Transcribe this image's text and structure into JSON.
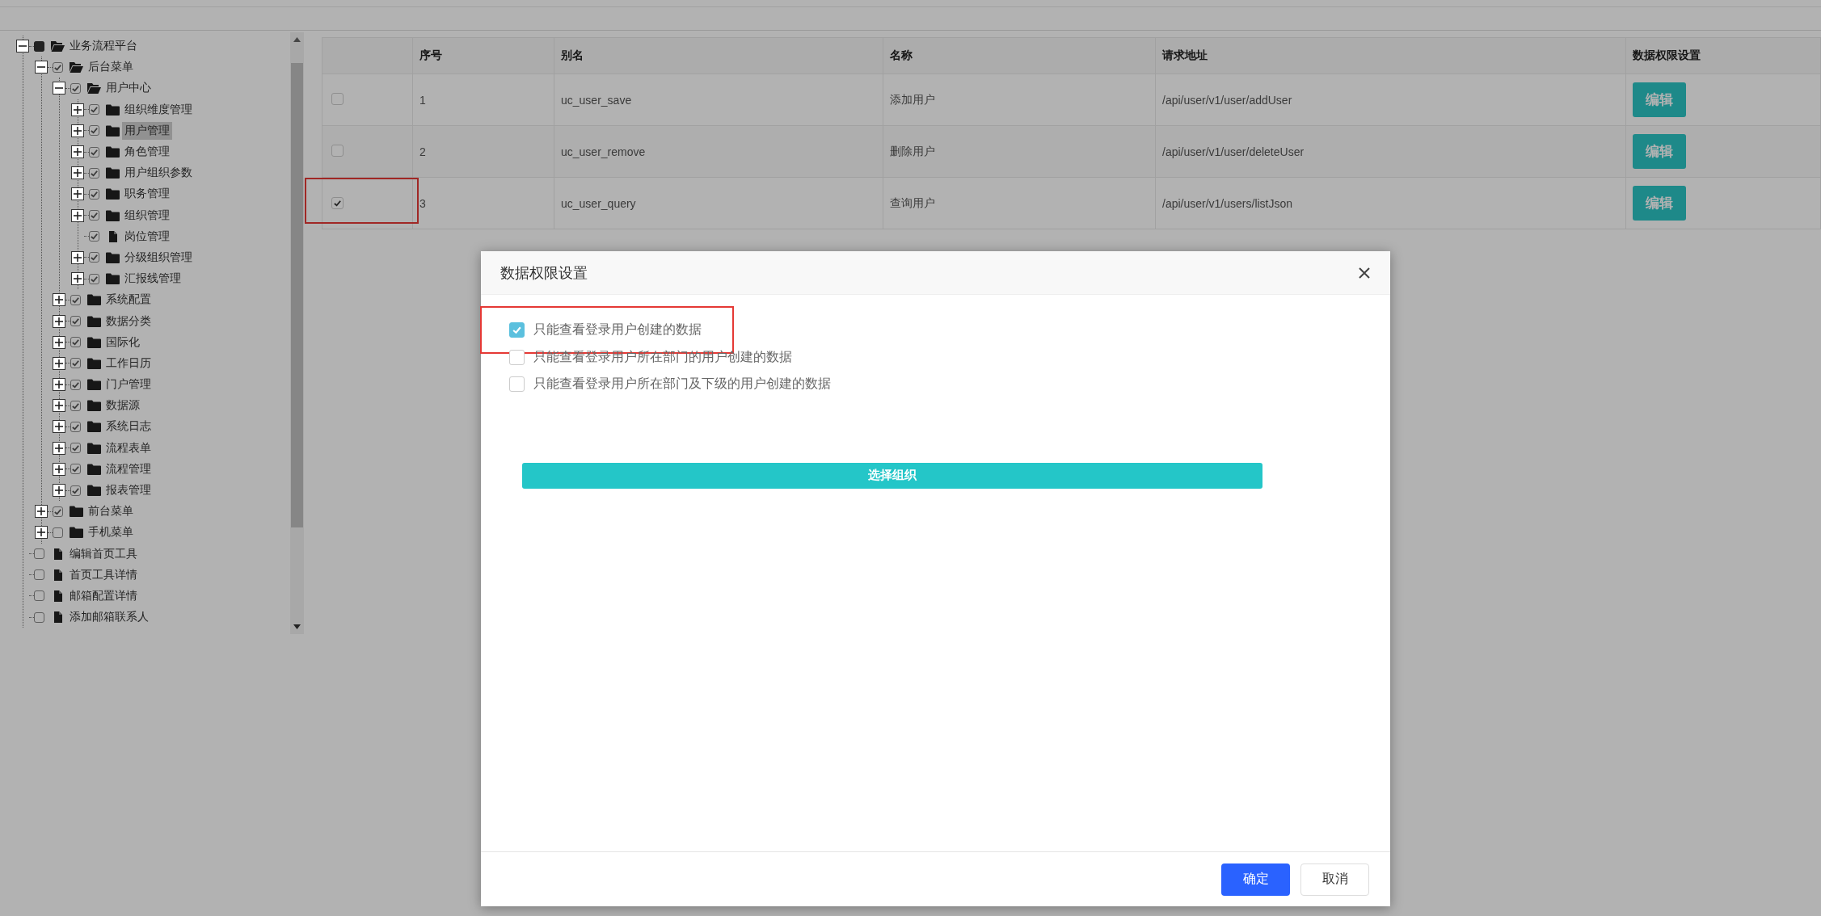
{
  "tree": [
    {
      "label": "业务流程平台",
      "kind": "folder",
      "expanded": true,
      "checked": false,
      "indeterminate": true,
      "selected": false,
      "children": [
        {
          "label": "后台菜单",
          "kind": "folder",
          "expanded": true,
          "checked": true,
          "indeterminate": false,
          "selected": false,
          "children": [
            {
              "label": "用户中心",
              "kind": "folder",
              "expanded": true,
              "checked": true,
              "indeterminate": false,
              "selected": false,
              "children": [
                {
                  "label": "组织维度管理",
                  "kind": "folder",
                  "expanded": false,
                  "checked": true,
                  "indeterminate": false,
                  "selected": false
                },
                {
                  "label": "用户管理",
                  "kind": "folder",
                  "expanded": false,
                  "checked": true,
                  "indeterminate": false,
                  "selected": true
                },
                {
                  "label": "角色管理",
                  "kind": "folder",
                  "expanded": false,
                  "checked": true,
                  "indeterminate": false,
                  "selected": false
                },
                {
                  "label": "用户组织参数",
                  "kind": "folder",
                  "expanded": false,
                  "checked": true,
                  "indeterminate": false,
                  "selected": false
                },
                {
                  "label": "职务管理",
                  "kind": "folder",
                  "expanded": false,
                  "checked": true,
                  "indeterminate": false,
                  "selected": false
                },
                {
                  "label": "组织管理",
                  "kind": "folder",
                  "expanded": false,
                  "checked": true,
                  "indeterminate": false,
                  "selected": false
                },
                {
                  "label": "岗位管理",
                  "kind": "file",
                  "checked": true,
                  "indeterminate": false,
                  "selected": false
                },
                {
                  "label": "分级组织管理",
                  "kind": "folder",
                  "expanded": false,
                  "checked": true,
                  "indeterminate": false,
                  "selected": false
                },
                {
                  "label": "汇报线管理",
                  "kind": "folder",
                  "expanded": false,
                  "checked": true,
                  "indeterminate": false,
                  "selected": false
                }
              ]
            },
            {
              "label": "系统配置",
              "kind": "folder",
              "expanded": false,
              "checked": true,
              "indeterminate": false,
              "selected": false
            },
            {
              "label": "数据分类",
              "kind": "folder",
              "expanded": false,
              "checked": true,
              "indeterminate": false,
              "selected": false
            },
            {
              "label": "国际化",
              "kind": "folder",
              "expanded": false,
              "checked": true,
              "indeterminate": false,
              "selected": false
            },
            {
              "label": "工作日历",
              "kind": "folder",
              "expanded": false,
              "checked": true,
              "indeterminate": false,
              "selected": false
            },
            {
              "label": "门户管理",
              "kind": "folder",
              "expanded": false,
              "checked": true,
              "indeterminate": false,
              "selected": false
            },
            {
              "label": "数据源",
              "kind": "folder",
              "expanded": false,
              "checked": true,
              "indeterminate": false,
              "selected": false
            },
            {
              "label": "系统日志",
              "kind": "folder",
              "expanded": false,
              "checked": true,
              "indeterminate": false,
              "selected": false
            },
            {
              "label": "流程表单",
              "kind": "folder",
              "expanded": false,
              "checked": true,
              "indeterminate": false,
              "selected": false
            },
            {
              "label": "流程管理",
              "kind": "folder",
              "expanded": false,
              "checked": true,
              "indeterminate": false,
              "selected": false
            },
            {
              "label": "报表管理",
              "kind": "folder",
              "expanded": false,
              "checked": true,
              "indeterminate": false,
              "selected": false
            }
          ]
        },
        {
          "label": "前台菜单",
          "kind": "folder",
          "expanded": false,
          "checked": true,
          "indeterminate": false,
          "selected": false
        },
        {
          "label": "手机菜单",
          "kind": "folder",
          "expanded": false,
          "checked": false,
          "indeterminate": false,
          "selected": false
        }
      ]
    },
    {
      "label": "编辑首页工具",
      "kind": "file",
      "checked": false,
      "indeterminate": false,
      "selected": false
    },
    {
      "label": "首页工具详情",
      "kind": "file",
      "checked": false,
      "indeterminate": false,
      "selected": false
    },
    {
      "label": "邮箱配置详情",
      "kind": "file",
      "checked": false,
      "indeterminate": false,
      "selected": false
    },
    {
      "label": "添加邮箱联系人",
      "kind": "file",
      "checked": false,
      "indeterminate": false,
      "selected": false
    }
  ],
  "table": {
    "columns": [
      "序号",
      "别名",
      "名称",
      "请求地址",
      "数据权限设置"
    ],
    "rows": [
      {
        "checked": false,
        "highlighted": false,
        "cells": [
          "1",
          "uc_user_save",
          "添加用户",
          "/api/user/v1/user/addUser"
        ],
        "action": "编辑"
      },
      {
        "checked": false,
        "highlighted": false,
        "cells": [
          "2",
          "uc_user_remove",
          "删除用户",
          "/api/user/v1/user/deleteUser"
        ],
        "action": "编辑"
      },
      {
        "checked": true,
        "highlighted": true,
        "cells": [
          "3",
          "uc_user_query",
          "查询用户",
          "/api/user/v1/users/listJson"
        ],
        "action": "编辑"
      }
    ]
  },
  "dialog": {
    "title": "数据权限设置",
    "options": [
      {
        "label": "只能查看登录用户创建的数据",
        "checked": true,
        "highlighted": true
      },
      {
        "label": "只能查看登录用户所在部门的用户创建的数据",
        "checked": false,
        "highlighted": false
      },
      {
        "label": "只能查看登录用户所在部门及下级的用户创建的数据",
        "checked": false,
        "highlighted": false
      }
    ],
    "select_button": "选择组织",
    "buttons": [
      {
        "label": "确定",
        "kind": "primary"
      },
      {
        "label": "取消",
        "kind": "default"
      }
    ]
  }
}
